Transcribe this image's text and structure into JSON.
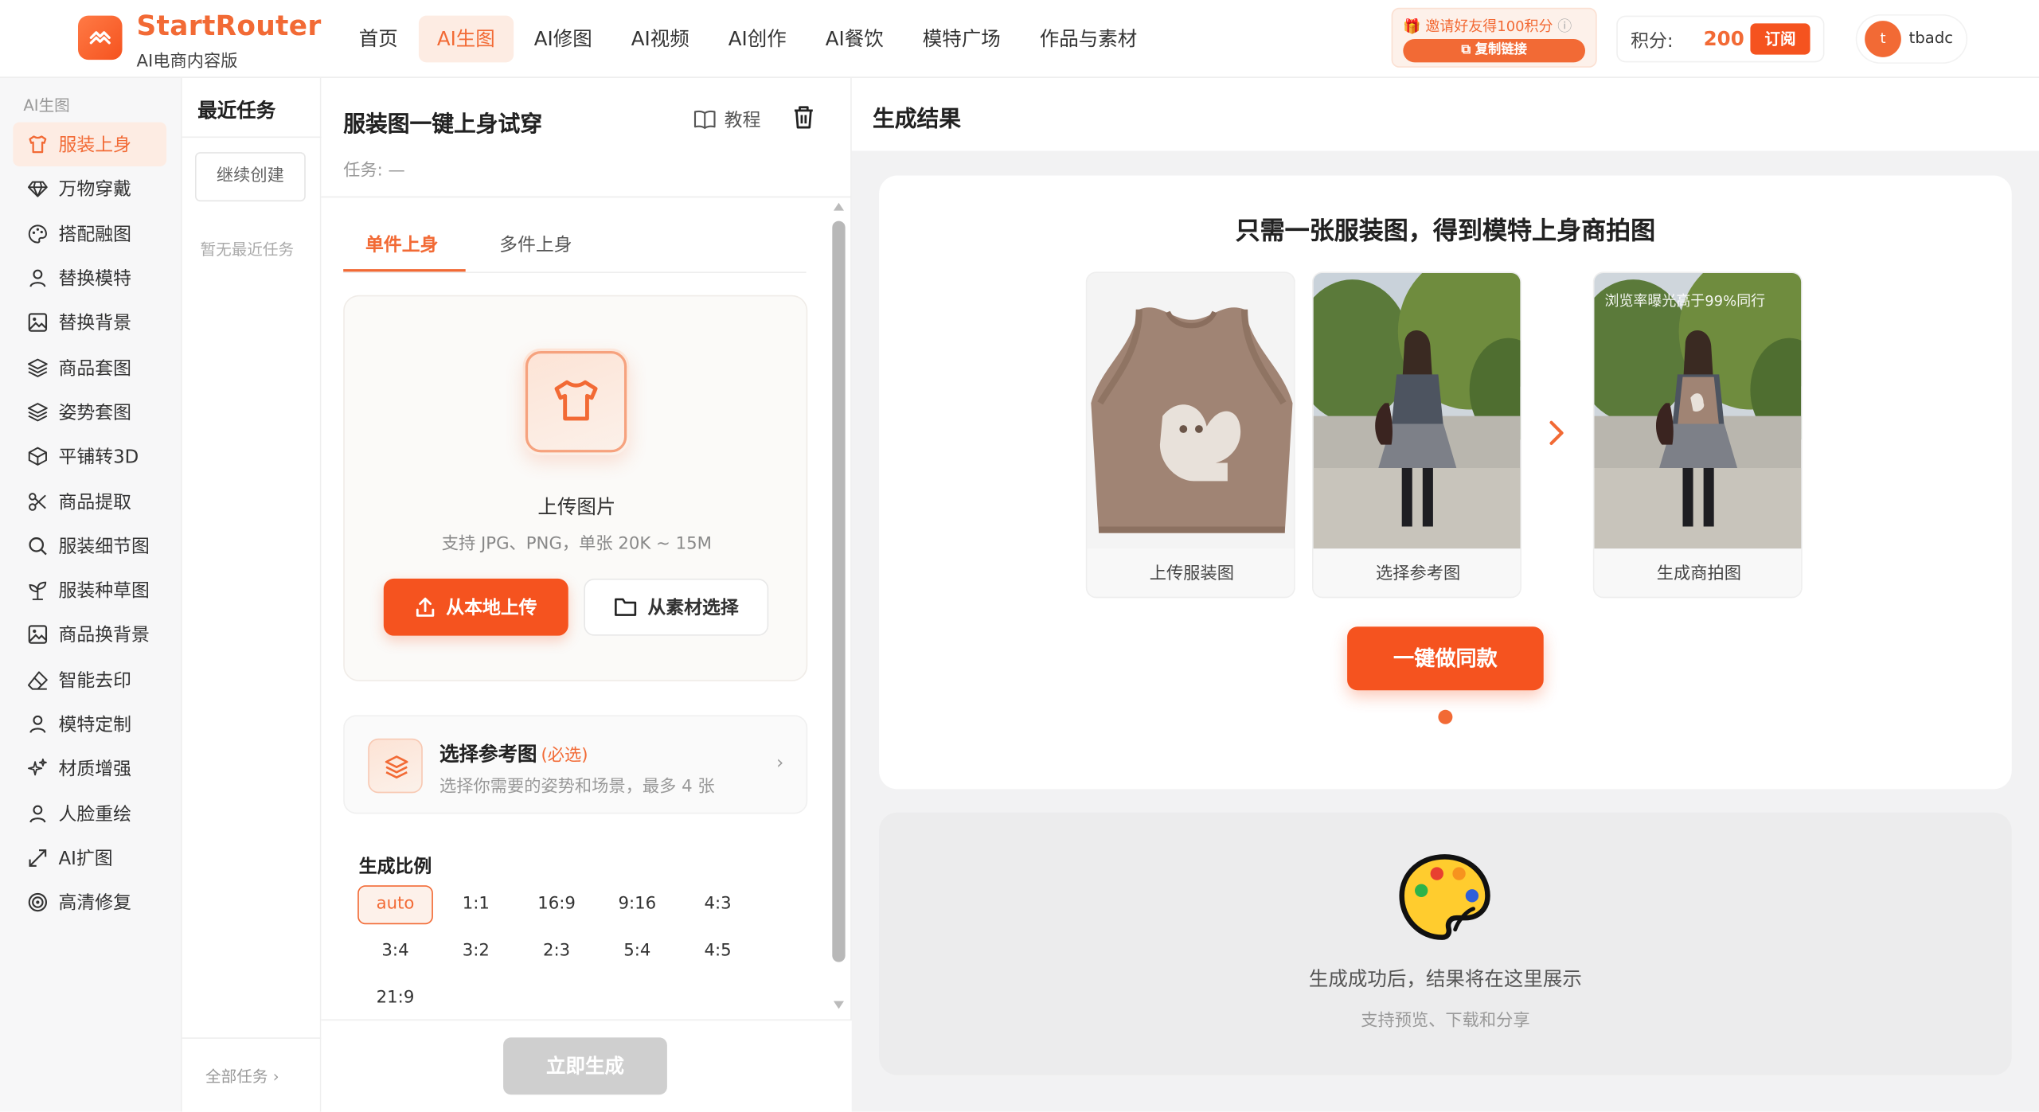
{
  "header": {
    "brand": "StartRouter",
    "brand_sub": "AI电商内容版",
    "nav": [
      "首页",
      "AI生图",
      "AI修图",
      "AI视频",
      "AI创作",
      "AI餐饮",
      "模特广场",
      "作品与素材"
    ],
    "nav_active": "AI生图",
    "invite_text": "邀请好友得100积分",
    "invite_button": "复制链接",
    "points_label": "积分:",
    "points_value": "200",
    "subscribe_button": "订阅",
    "avatar_letter": "t",
    "username": "tbadc"
  },
  "sidebar": {
    "group": "AI生图",
    "items": [
      {
        "label": "服装上身",
        "icon": "shirt-icon",
        "active": true
      },
      {
        "label": "万物穿戴",
        "icon": "diamond-icon"
      },
      {
        "label": "搭配融图",
        "icon": "palette-icon"
      },
      {
        "label": "替换模特",
        "icon": "person-icon"
      },
      {
        "label": "替换背景",
        "icon": "image-icon"
      },
      {
        "label": "商品套图",
        "icon": "layers-icon"
      },
      {
        "label": "姿势套图",
        "icon": "layers-icon"
      },
      {
        "label": "平铺转3D",
        "icon": "cube-icon"
      },
      {
        "label": "商品提取",
        "icon": "scissors-icon"
      },
      {
        "label": "服装细节图",
        "icon": "search-icon"
      },
      {
        "label": "服装种草图",
        "icon": "sprout-icon"
      },
      {
        "label": "商品换背景",
        "icon": "image-icon"
      },
      {
        "label": "智能去印",
        "icon": "eraser-icon"
      },
      {
        "label": "模特定制",
        "icon": "person-icon"
      },
      {
        "label": "材质增强",
        "icon": "sparkle-icon"
      },
      {
        "label": "人脸重绘",
        "icon": "person-icon"
      },
      {
        "label": "AI扩图",
        "icon": "expand-icon"
      },
      {
        "label": "高清修复",
        "icon": "target-icon"
      }
    ]
  },
  "recent": {
    "title": "最近任务",
    "continue": "继续创建",
    "empty": "暂无最近任务",
    "all_tasks": "全部任务 ›"
  },
  "form": {
    "title": "服装图一键上身试穿",
    "tutorial": "教程",
    "task": "任务: —",
    "tabs": [
      "单件上身",
      "多件上身"
    ],
    "upload_title": "上传图片",
    "upload_sub": "支持 JPG、PNG，单张 20K ~ 15M",
    "local_upload": "从本地上传",
    "asset_select": "从素材选择",
    "ref_title": "选择参考图",
    "ref_required": "(必选)",
    "ref_sub": "选择你需要的姿势和场景，最多 4 张",
    "ratio_title": "生成比例",
    "ratios": [
      "auto",
      "1:1",
      "16:9",
      "9:16",
      "4:3",
      "3:4",
      "3:2",
      "2:3",
      "5:4",
      "4:5",
      "21:9"
    ],
    "ratio_selected": "auto",
    "generate": "立即生成"
  },
  "result": {
    "title": "生成结果",
    "card_title": "只需一张服装图，得到模特上身商拍图",
    "captions": [
      "上传服装图",
      "选择参考图",
      "生成商拍图"
    ],
    "watermark": "浏览率曝光高于99%同行",
    "same_button": "一键做同款",
    "empty_title": "生成成功后，结果将在这里展示",
    "empty_sub": "支持预览、下载和分享"
  },
  "colors": {
    "accent": "#f26a35",
    "accent_strong": "#f5531f",
    "disabled": "#cfcfcf"
  }
}
